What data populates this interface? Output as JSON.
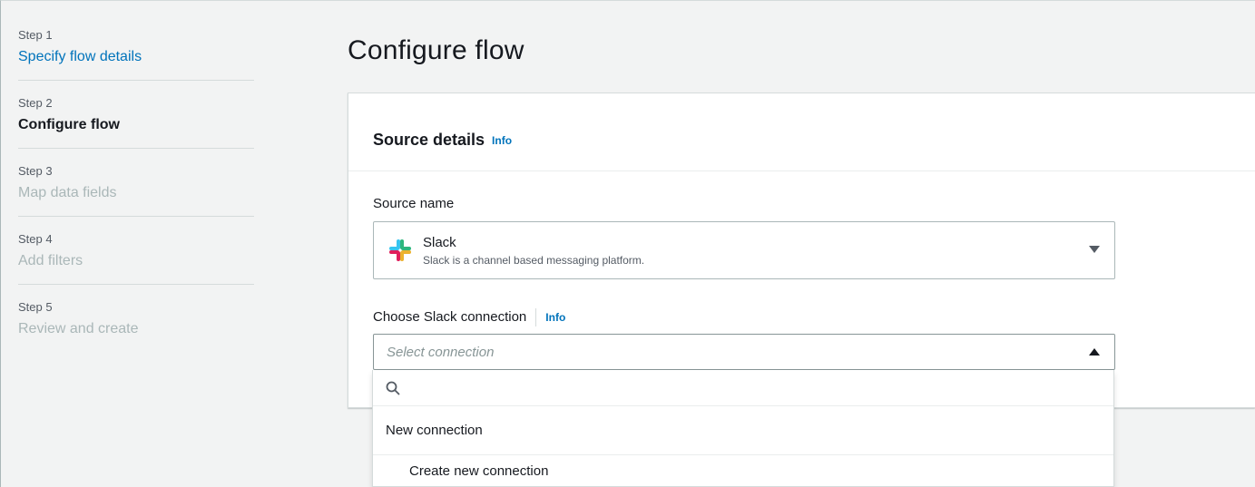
{
  "steps": [
    {
      "num": "Step 1",
      "title": "Specify flow details",
      "state": "link"
    },
    {
      "num": "Step 2",
      "title": "Configure flow",
      "state": "active"
    },
    {
      "num": "Step 3",
      "title": "Map data fields",
      "state": "disabled"
    },
    {
      "num": "Step 4",
      "title": "Add filters",
      "state": "disabled"
    },
    {
      "num": "Step 5",
      "title": "Review and create",
      "state": "disabled"
    }
  ],
  "page": {
    "title": "Configure flow"
  },
  "source_details": {
    "heading": "Source details",
    "info": "Info",
    "source_name_label": "Source name",
    "selected_source": {
      "name": "Slack",
      "description": "Slack is a channel based messaging platform.",
      "icon": "slack-logo"
    },
    "connection_label": "Choose Slack connection",
    "connection_info": "Info",
    "connection_placeholder": "Select connection"
  },
  "dropdown": {
    "search_icon": "search-icon",
    "group_label": "New connection",
    "options": [
      "Create new connection"
    ]
  },
  "colors": {
    "link": "#0073bb",
    "background": "#f2f3f3",
    "disabled": "#aab7b8"
  }
}
